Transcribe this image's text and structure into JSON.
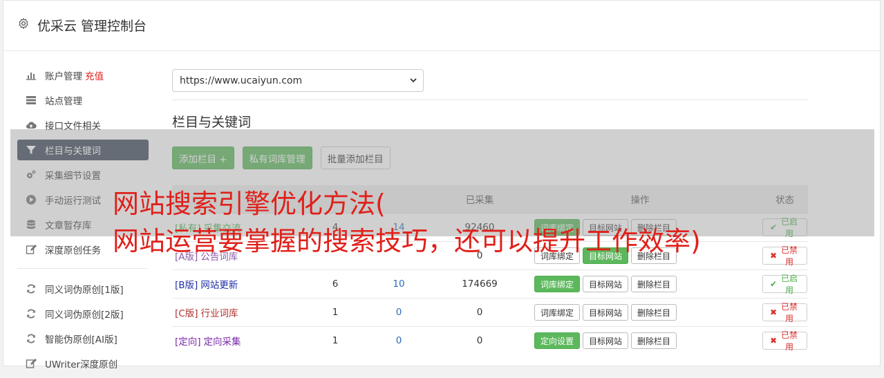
{
  "app_title": "优采云 管理控制台",
  "sidebar": {
    "items": [
      {
        "label": "账户管理",
        "extra": "充值",
        "icon": "bar-chart-icon"
      },
      {
        "label": "站点管理",
        "icon": "server-icon"
      },
      {
        "label": "接口文件相关",
        "icon": "cloud-upload-icon"
      },
      {
        "label": "栏目与关键词",
        "icon": "filter-icon",
        "active": true
      },
      {
        "label": "采集细节设置",
        "icon": "cogs-icon"
      },
      {
        "label": "手动运行测试",
        "icon": "play-circle-icon"
      },
      {
        "label": "文章暂存库",
        "icon": "database-icon"
      },
      {
        "label": "深度原创任务",
        "icon": "edit-icon"
      },
      {
        "label": "同义词伪原创[1版]",
        "icon": "refresh-icon"
      },
      {
        "label": "同义词伪原创[2版]",
        "icon": "refresh-icon"
      },
      {
        "label": "智能伪原创[AI版]",
        "icon": "refresh-icon"
      },
      {
        "label": "UWriter深度原创",
        "icon": "edit-icon"
      }
    ]
  },
  "main": {
    "site_select": "https://www.ucaiyun.com",
    "section_title": "栏目与关键词",
    "buttons": {
      "add_column": "添加栏目 +",
      "private_lib": "私有词库管理",
      "batch_add": "批量添加栏目"
    },
    "table": {
      "headers": [
        "",
        "",
        "",
        "已采集",
        "操作",
        "状态"
      ],
      "rows": [
        {
          "tag": "[私有]",
          "name": "采集交流",
          "cls": "c-private",
          "count1": "4",
          "count2": "14",
          "collected": "92460",
          "op1": "词库绑定",
          "op1_green": true,
          "op2": "目标网站",
          "op3": "删除栏目",
          "status": "已启用",
          "on": true
        },
        {
          "tag": "[A版]",
          "name": "公告词库",
          "cls": "c-a",
          "count1": "",
          "count2": "",
          "collected": "0",
          "op1": "词库绑定",
          "op1_green": false,
          "op2": "目标网站",
          "op2_green": true,
          "op3": "删除栏目",
          "status": "已禁用",
          "on": false
        },
        {
          "tag": "[B版]",
          "name": "网站更新",
          "cls": "c-b",
          "count1": "6",
          "count2": "10",
          "collected": "174669",
          "op1": "词库绑定",
          "op1_green": true,
          "op2": "目标网站",
          "op3": "删除栏目",
          "status": "已启用",
          "on": true
        },
        {
          "tag": "[C版]",
          "name": "行业词库",
          "cls": "c-c",
          "count1": "1",
          "count2": "0",
          "collected": "0",
          "op1": "词库绑定",
          "op1_green": false,
          "op2": "目标网站",
          "op3": "删除栏目",
          "status": "已禁用",
          "on": false
        },
        {
          "tag": "[定向]",
          "name": "定向采集",
          "cls": "c-dir",
          "count1": "1",
          "count2": "0",
          "collected": "0",
          "op1": "定向设置",
          "op1_green": true,
          "op2": "目标网站",
          "op3": "删除栏目",
          "status": "已禁用",
          "on": false
        }
      ]
    }
  },
  "overlay": {
    "line1": "网站搜索引擎优化方法(",
    "line2": "网站运营要掌握的搜索技巧，还可以提升工作效率)"
  },
  "colors": {
    "active_nav": "#3d4a5c",
    "green": "#5cb85c",
    "red_text": "#e0201a"
  }
}
